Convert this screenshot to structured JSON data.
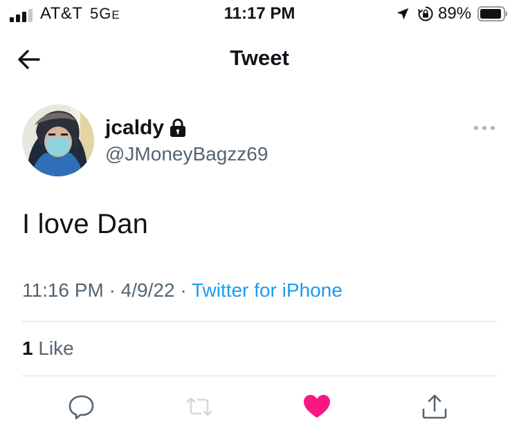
{
  "status_bar": {
    "carrier": "AT&T",
    "network": "5G",
    "network_suffix": "E",
    "time": "11:17 PM",
    "battery": "89%",
    "icons": [
      "signal-icon",
      "location-arrow-icon",
      "rotation-lock-icon",
      "battery-icon"
    ]
  },
  "nav": {
    "title": "Tweet",
    "back_icon": "back-arrow-icon"
  },
  "tweet": {
    "author_name": "jcaldy",
    "author_handle": "@JMoneyBagzz69",
    "protected_icon": "lock-icon",
    "more_icon": "more-dots-icon",
    "text": "I love Dan",
    "time": "11:16 PM",
    "sep1": "·",
    "date": "4/9/22",
    "sep2": "·",
    "source": "Twitter for iPhone",
    "like_count": "1",
    "like_label": "Like"
  },
  "actions": {
    "icons": [
      "reply-icon",
      "retweet-icon",
      "like-icon",
      "share-icon"
    ]
  },
  "colors": {
    "accent": "#1d9bf0",
    "like": "#f91880",
    "secondary_text": "#536471",
    "disabled": "#cfd9de"
  }
}
